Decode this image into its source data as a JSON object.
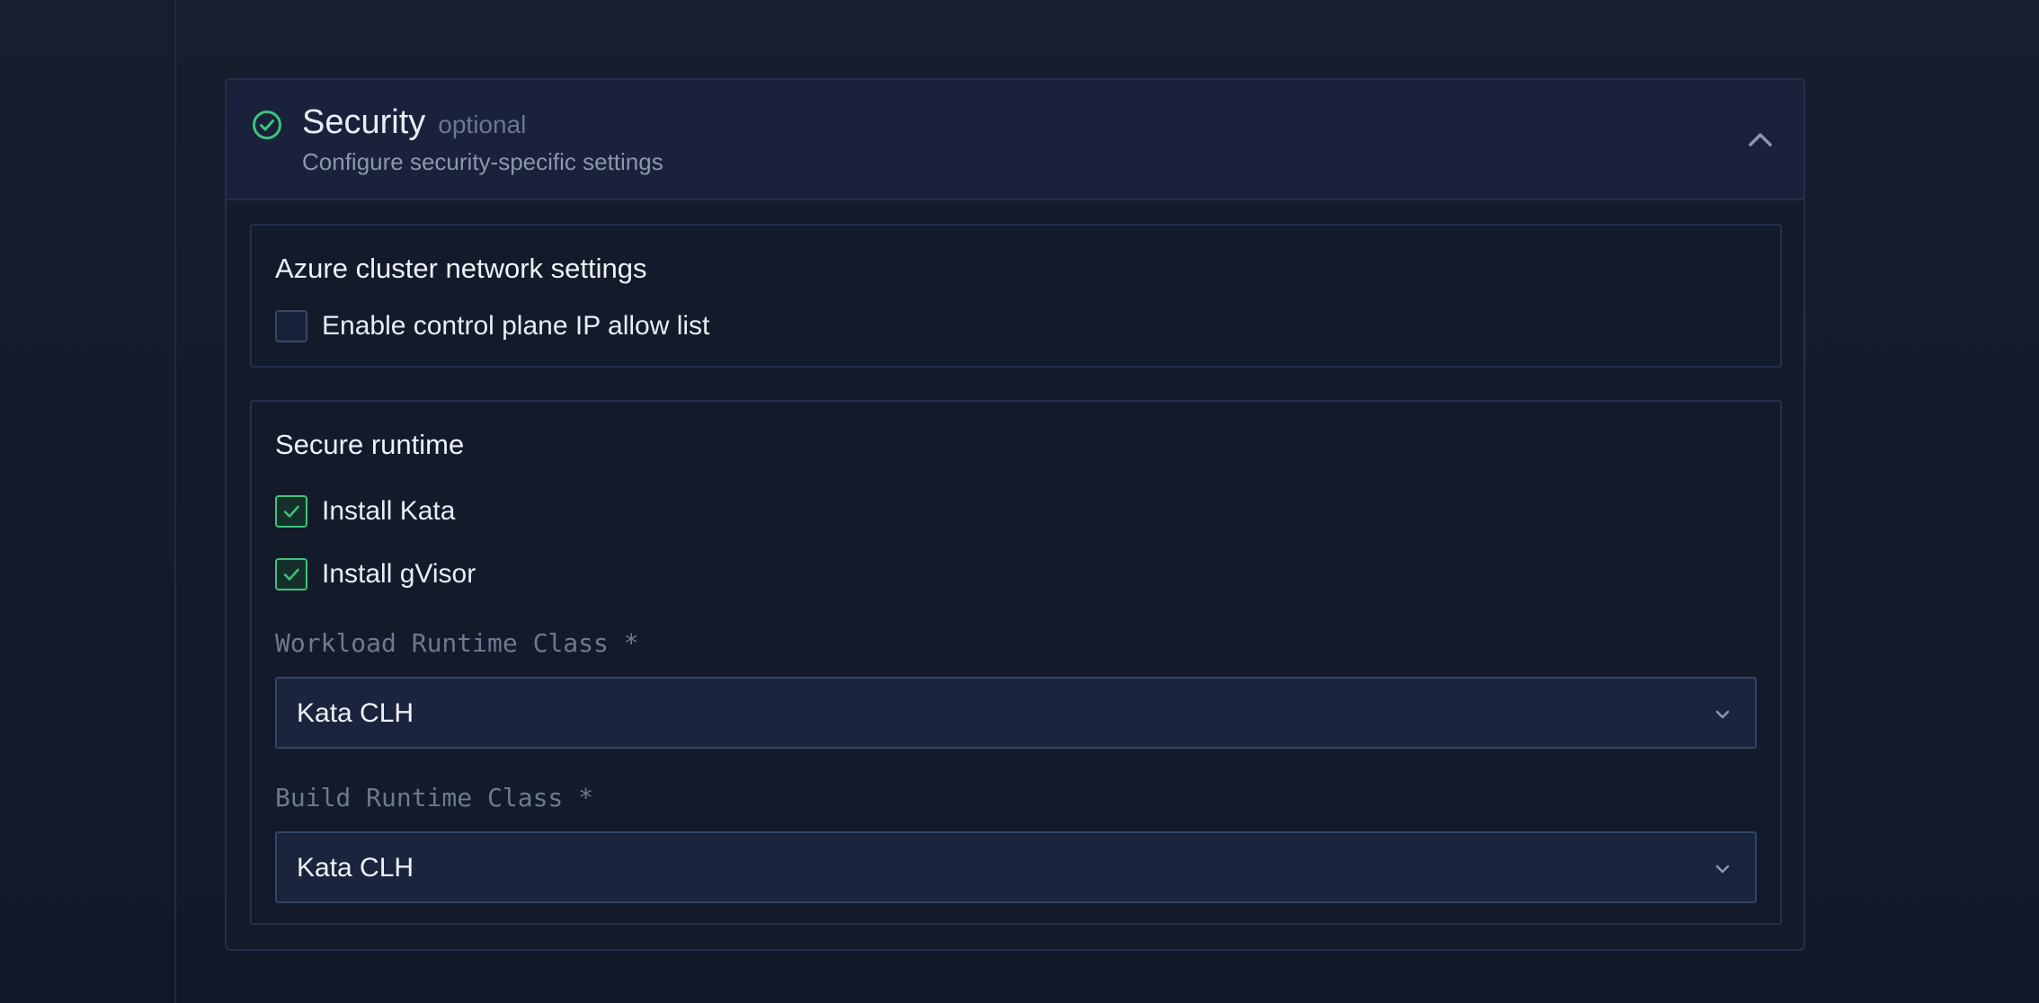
{
  "panel": {
    "title": "Security",
    "optional_tag": "optional",
    "subtitle": "Configure security-specific settings",
    "status_color": "#3ec47c"
  },
  "network_section": {
    "title": "Azure cluster network settings",
    "ip_allow_list": {
      "label": "Enable control plane IP allow list",
      "checked": false
    }
  },
  "runtime_section": {
    "title": "Secure runtime",
    "install_kata": {
      "label": "Install Kata",
      "checked": true
    },
    "install_gvisor": {
      "label": "Install gVisor",
      "checked": true
    },
    "workload_runtime": {
      "label": "Workload Runtime Class *",
      "value": "Kata CLH"
    },
    "build_runtime": {
      "label": "Build Runtime Class *",
      "value": "Kata CLH"
    }
  }
}
